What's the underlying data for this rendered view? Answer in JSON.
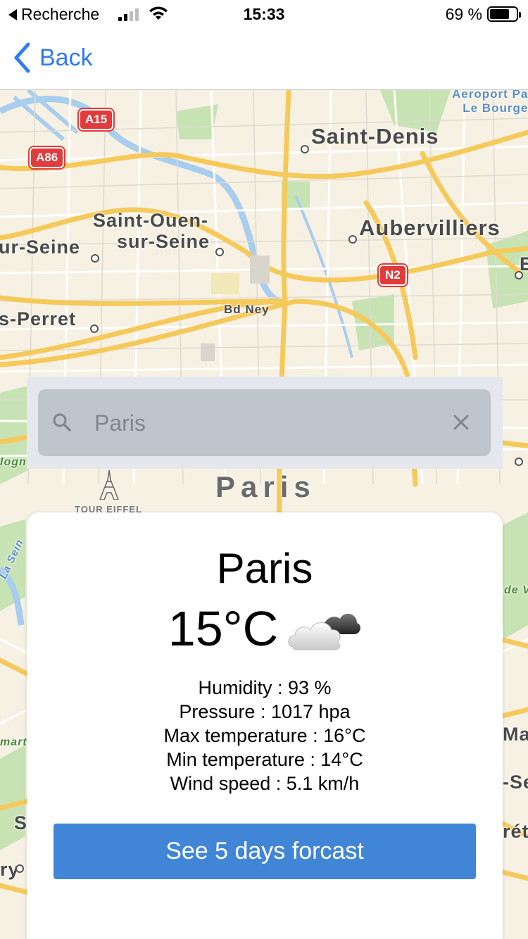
{
  "status_bar": {
    "back_app": "Recherche",
    "time": "15:33",
    "battery": "69 %",
    "battery_level": 0.69,
    "signal_bars_active": 2,
    "signal_bars_total": 4
  },
  "nav": {
    "back_label": "Back",
    "accent_color": "#2f7bf2"
  },
  "map": {
    "labels": {
      "saint_denis": "Saint-Denis",
      "aubervilliers": "Aubervilliers",
      "saint_ouen_line1": "Saint-Ouen-",
      "saint_ouen_line2": "sur-Seine",
      "ur_seine": "ur-Seine",
      "levallois": "s-Perret",
      "bd_ney": "Bd Ney",
      "paris": "Paris",
      "tour_eiffel": "TOUR EIFFEL",
      "aeroport_line1": "Aeroport Pa",
      "aeroport_line2": "Le Bourge",
      "la_seine": "La Sein",
      "boulogne": "logn",
      "mart": "mart",
      "de_v": "de V",
      "ma": "Ma",
      "se": "-Se",
      "ret": "rét",
      "s": "S",
      "ry": "ry",
      "e": "E"
    },
    "shields": {
      "a15": "A15",
      "a86": "A86",
      "n2": "N2"
    }
  },
  "search": {
    "value": "Paris",
    "placeholder": "Search"
  },
  "weather": {
    "city": "Paris",
    "temperature": "15°C",
    "icon": "cloud-icon",
    "humidity": "Humidity : 93 %",
    "pressure": "Pressure : 1017 hpa",
    "max_temp": "Max temperature : 16°C",
    "min_temp": "Min temperature : 14°C",
    "wind": "Wind speed : 5.1 km/h",
    "forecast_button": "See 5 days forcast",
    "button_color": "#4185d6"
  }
}
